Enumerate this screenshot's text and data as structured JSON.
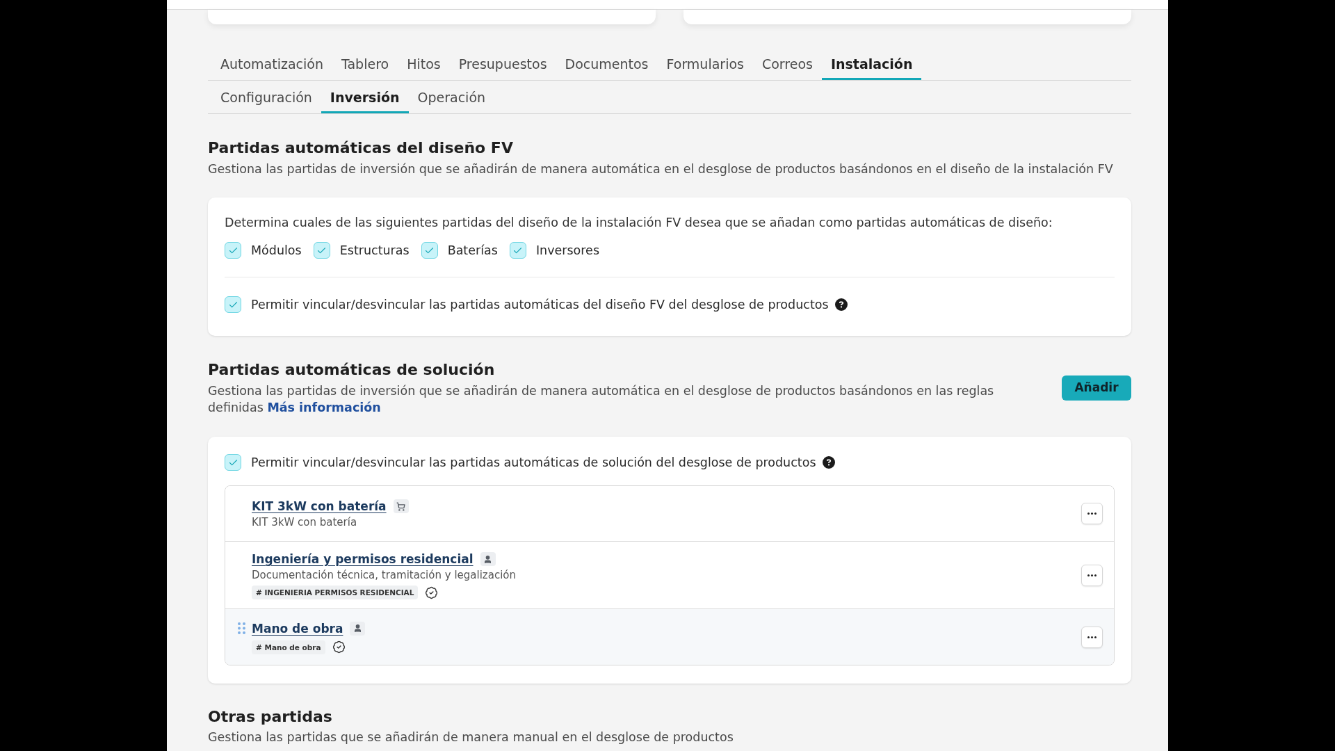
{
  "tabs": [
    {
      "label": "Automatización",
      "selected": false
    },
    {
      "label": "Tablero",
      "selected": false
    },
    {
      "label": "Hitos",
      "selected": false
    },
    {
      "label": "Presupuestos",
      "selected": false
    },
    {
      "label": "Documentos",
      "selected": false
    },
    {
      "label": "Formularios",
      "selected": false
    },
    {
      "label": "Correos",
      "selected": false
    },
    {
      "label": "Instalación",
      "selected": true
    }
  ],
  "subtabs": [
    {
      "label": "Configuración",
      "selected": false
    },
    {
      "label": "Inversión",
      "selected": true
    },
    {
      "label": "Operación",
      "selected": false
    }
  ],
  "design_section": {
    "title": "Partidas automáticas del diseño FV",
    "description": "Gestiona las partidas de inversión que se añadirán de manera automática en el desglose de productos basándonos en el diseño de la instalación FV",
    "prompt": "Determina cuales de las siguientes partidas del diseño de la instalación FV desea que se añadan como partidas automáticas de diseño:",
    "options": [
      {
        "label": "Módulos",
        "checked": true
      },
      {
        "label": "Estructuras",
        "checked": true
      },
      {
        "label": "Baterías",
        "checked": true
      },
      {
        "label": "Inversores",
        "checked": true
      }
    ],
    "link_toggle": {
      "label": "Permitir vincular/desvincular las partidas automáticas del diseño FV del desglose de productos",
      "checked": true
    }
  },
  "solution_section": {
    "title": "Partidas automáticas de solución",
    "description": "Gestiona las partidas de inversión que se añadirán de manera automática en el desglose de productos basándonos en las reglas definidas",
    "link": "Más información",
    "add_button": "Añadir",
    "link_toggle": {
      "label": "Permitir vincular/desvincular las partidas automáticas de solución del desglose de productos",
      "checked": true
    },
    "items": [
      {
        "title": "KIT 3kW con batería",
        "kind": "product",
        "subtitle": "KIT 3kW con batería",
        "hovered": false
      },
      {
        "title": "Ingeniería y permisos residencial",
        "kind": "service",
        "subtitle": "Documentación técnica, tramitación y legalización",
        "tag": "# INGENIERIA PERMISOS RESIDENCIAL",
        "verified": true,
        "hovered": false
      },
      {
        "title": "Mano de obra",
        "kind": "service",
        "tag": "# Mano de obra",
        "verified": true,
        "hovered": true
      }
    ]
  },
  "other_section": {
    "title": "Otras partidas",
    "description": "Gestiona las partidas que se añadirán de manera manual en el desglose de productos"
  }
}
